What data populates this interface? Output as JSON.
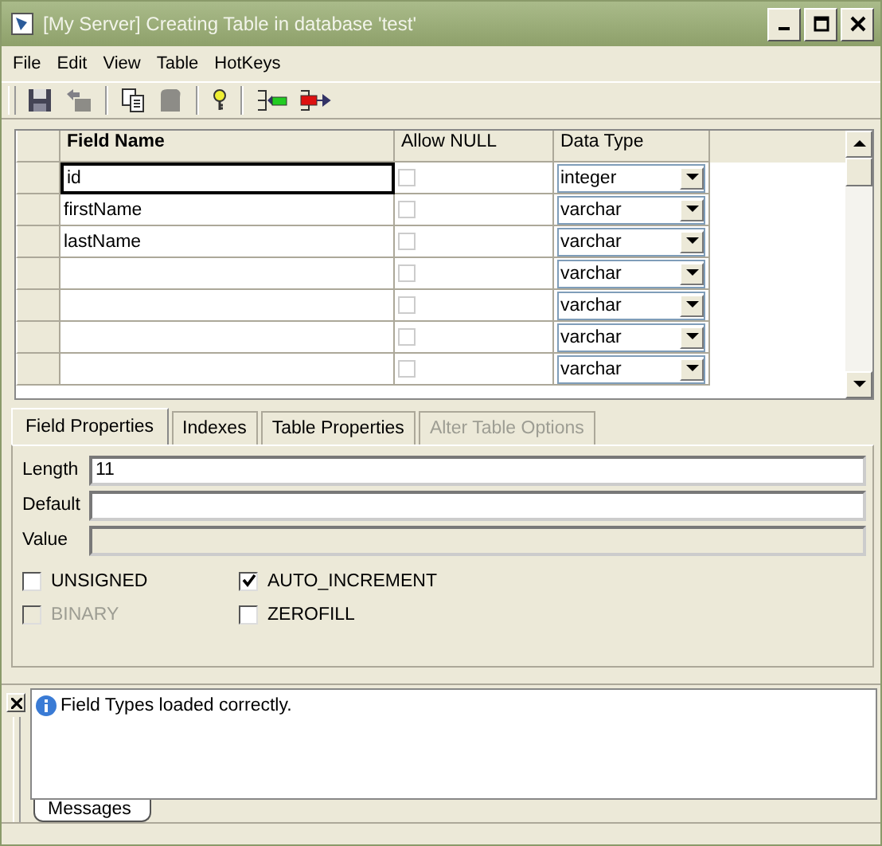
{
  "window": {
    "title": "[My Server] Creating Table in database 'test'"
  },
  "menu": [
    "File",
    "Edit",
    "View",
    "Table",
    "HotKeys"
  ],
  "toolbar": [
    {
      "kind": "save",
      "disabled": false
    },
    {
      "kind": "back",
      "disabled": true
    },
    {
      "kind": "sep"
    },
    {
      "kind": "copy",
      "disabled": false
    },
    {
      "kind": "paste",
      "disabled": true
    },
    {
      "kind": "sep"
    },
    {
      "kind": "key",
      "disabled": false
    },
    {
      "kind": "sep"
    },
    {
      "kind": "insert",
      "disabled": false
    },
    {
      "kind": "delete",
      "disabled": false
    }
  ],
  "table": {
    "columns": [
      "Field Name",
      "Allow NULL",
      "Data Type"
    ],
    "rows": [
      {
        "name": "id",
        "allow_null": false,
        "type": "integer",
        "focused": true
      },
      {
        "name": "firstName",
        "allow_null": false,
        "type": "varchar",
        "focused": false
      },
      {
        "name": "lastName",
        "allow_null": false,
        "type": "varchar",
        "focused": false
      },
      {
        "name": "",
        "allow_null": false,
        "type": "varchar",
        "focused": false
      },
      {
        "name": "",
        "allow_null": false,
        "type": "varchar",
        "focused": false
      },
      {
        "name": "",
        "allow_null": false,
        "type": "varchar",
        "focused": false
      },
      {
        "name": "",
        "allow_null": false,
        "type": "varchar",
        "focused": false
      }
    ]
  },
  "tabs": [
    {
      "label": "Field Properties",
      "selected": true,
      "disabled": false
    },
    {
      "label": "Indexes",
      "selected": false,
      "disabled": false
    },
    {
      "label": "Table Properties",
      "selected": false,
      "disabled": false
    },
    {
      "label": "Alter Table Options",
      "selected": false,
      "disabled": true
    }
  ],
  "fields": [
    {
      "label": "Length",
      "value": "11",
      "disabled": false
    },
    {
      "label": "Default",
      "disabled": false
    },
    {
      "label": "Value",
      "disabled": true
    }
  ],
  "options": [
    [
      {
        "label": "UNSIGNED",
        "checked": false,
        "disabled": false
      },
      {
        "label": "BINARY",
        "checked": false,
        "disabled": true
      }
    ],
    [
      {
        "label": "AUTO_INCREMENT",
        "checked": true,
        "disabled": false
      },
      {
        "label": "ZEROFILL",
        "checked": false,
        "disabled": false
      }
    ]
  ],
  "messages": {
    "items": [
      "Field Types loaded correctly."
    ],
    "tab": "Messages"
  }
}
